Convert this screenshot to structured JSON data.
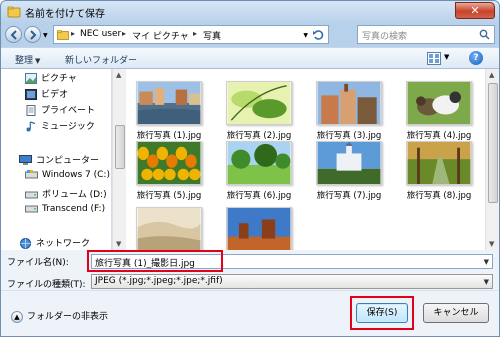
{
  "window": {
    "title": "名前を付けて保存",
    "close_label": "✕"
  },
  "address": {
    "crumbs": [
      "NEC user",
      "マイ ピクチャ",
      "写真"
    ],
    "separator": "▸",
    "search_placeholder": "写真の検索"
  },
  "toolbar": {
    "organize": "整理",
    "new_folder": "新しいフォルダー"
  },
  "nav": {
    "items": [
      {
        "label": "ピクチャ",
        "icon": "pictures-icon"
      },
      {
        "label": "ビデオ",
        "icon": "video-icon"
      },
      {
        "label": "プライベート",
        "icon": "document-icon"
      },
      {
        "label": "ミュージック",
        "icon": "music-icon"
      },
      {
        "label": "コンピューター",
        "icon": "computer-icon"
      },
      {
        "label": "Windows 7 (C:)",
        "icon": "drive-icon"
      },
      {
        "label": "ボリューム (D:)",
        "icon": "drive-icon"
      },
      {
        "label": "Transcend (F:)",
        "icon": "drive-icon"
      },
      {
        "label": "ネットワーク",
        "icon": "network-icon"
      }
    ]
  },
  "files": [
    {
      "label": "旅行写真 (1).jpg",
      "scene": "canal-town",
      "colors": [
        "#9cc0e6",
        "#c98a58",
        "#4f6f8a"
      ]
    },
    {
      "label": "旅行写真 (2).jpg",
      "scene": "green-leaves",
      "colors": [
        "#b7db6a",
        "#5a9a2a",
        "#e8f2b0"
      ]
    },
    {
      "label": "旅行写真 (3).jpg",
      "scene": "city-buildings",
      "colors": [
        "#8fb7e2",
        "#c97a4a",
        "#7a5a3a"
      ]
    },
    {
      "label": "旅行写真 (4).jpg",
      "scene": "ducklings",
      "colors": [
        "#7ea94a",
        "#f2f2f2",
        "#6a5a3a"
      ]
    },
    {
      "label": "旅行写真 (5).jpg",
      "scene": "tulips",
      "colors": [
        "#f0b400",
        "#e57b00",
        "#3f7a2a"
      ]
    },
    {
      "label": "旅行写真 (6).jpg",
      "scene": "meadow-trees",
      "colors": [
        "#a9d3f0",
        "#3f8a2a",
        "#7fc24a"
      ]
    },
    {
      "label": "旅行写真 (7).jpg",
      "scene": "castle",
      "colors": [
        "#5d9ad8",
        "#eef2f6",
        "#3f6a2a"
      ]
    },
    {
      "label": "旅行写真 (8).jpg",
      "scene": "forest-path",
      "colors": [
        "#c9a24a",
        "#6a8a2a",
        "#9fb87a"
      ]
    },
    {
      "label": "",
      "scene": "beach-dune",
      "colors": [
        "#d9c7a4",
        "#b8a27a",
        "#ece2cc"
      ]
    },
    {
      "label": "",
      "scene": "red-rocks",
      "colors": [
        "#3f7ac9",
        "#c2652a",
        "#8a3f1a"
      ]
    }
  ],
  "form": {
    "filename_label": "ファイル名(N):",
    "filename_value": "旅行写真 (1)_撮影日.jpg",
    "filetype_label": "ファイルの種類(T):",
    "filetype_value": "JPEG (*.jpg;*.jpeg;*.jpe;*.jfif)"
  },
  "footer": {
    "hide_folders": "フォルダーの非表示",
    "save": "保存(S)",
    "cancel": "キャンセル"
  },
  "colors": {
    "highlight": "#e3001b",
    "accent": "#3c7fb1"
  }
}
